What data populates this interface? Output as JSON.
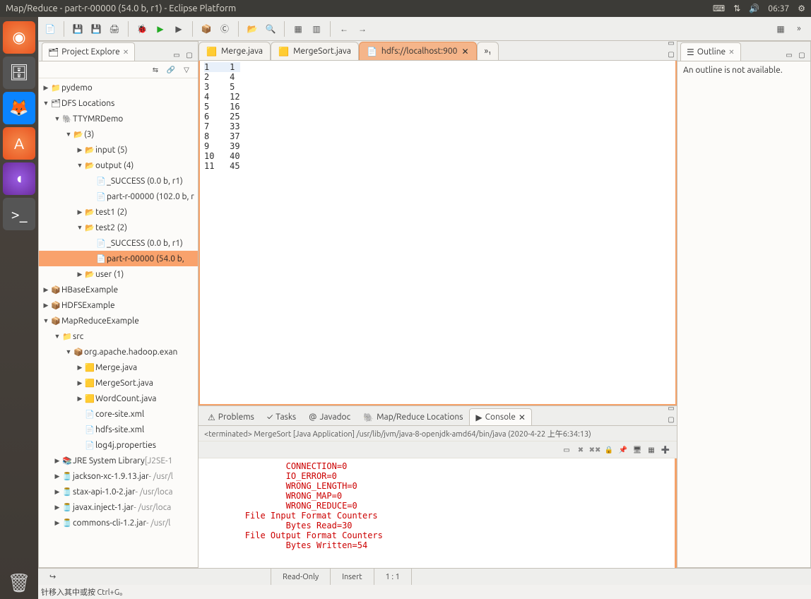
{
  "title": "Map/Reduce - part-r-00000 (54.0 b, r1) - Eclipse Platform",
  "clock": "06:37",
  "explorer": {
    "tab": "Project Explore",
    "items": [
      {
        "depth": 0,
        "twist": "▶",
        "icon": "📁",
        "label": "pydemo"
      },
      {
        "depth": 0,
        "twist": "▼",
        "icon": "🗂",
        "label": "DFS Locations"
      },
      {
        "depth": 1,
        "twist": "▼",
        "icon": "🐘",
        "label": "TTYMRDemo"
      },
      {
        "depth": 2,
        "twist": "▼",
        "icon": "📂",
        "label": "(3)"
      },
      {
        "depth": 3,
        "twist": "▶",
        "icon": "📂",
        "label": "input (5)"
      },
      {
        "depth": 3,
        "twist": "▼",
        "icon": "📂",
        "label": "output (4)"
      },
      {
        "depth": 4,
        "twist": "",
        "icon": "📄",
        "label": "_SUCCESS (0.0 b, r1)"
      },
      {
        "depth": 4,
        "twist": "",
        "icon": "📄",
        "label": "part-r-00000 (102.0 b, r"
      },
      {
        "depth": 3,
        "twist": "▶",
        "icon": "📂",
        "label": "test1 (2)"
      },
      {
        "depth": 3,
        "twist": "▼",
        "icon": "📂",
        "label": "test2 (2)"
      },
      {
        "depth": 4,
        "twist": "",
        "icon": "📄",
        "label": "_SUCCESS (0.0 b, r1)"
      },
      {
        "depth": 4,
        "twist": "",
        "icon": "📄",
        "label": "part-r-00000 (54.0 b,",
        "selected": true
      },
      {
        "depth": 3,
        "twist": "▶",
        "icon": "📂",
        "label": "user (1)"
      },
      {
        "depth": 0,
        "twist": "▶",
        "icon": "📦",
        "label": "HBaseExample"
      },
      {
        "depth": 0,
        "twist": "▶",
        "icon": "📦",
        "label": "HDFSExample"
      },
      {
        "depth": 0,
        "twist": "▼",
        "icon": "📦",
        "label": "MapReduceExample"
      },
      {
        "depth": 1,
        "twist": "▼",
        "icon": "📁",
        "label": "src"
      },
      {
        "depth": 2,
        "twist": "▼",
        "icon": "📦",
        "label": "org.apache.hadoop.exan"
      },
      {
        "depth": 3,
        "twist": "▶",
        "icon": "🟨",
        "label": "Merge.java"
      },
      {
        "depth": 3,
        "twist": "▶",
        "icon": "🟨",
        "label": "MergeSort.java"
      },
      {
        "depth": 3,
        "twist": "▶",
        "icon": "🟨",
        "label": "WordCount.java"
      },
      {
        "depth": 3,
        "twist": "",
        "icon": "📄",
        "label": "core-site.xml"
      },
      {
        "depth": 3,
        "twist": "",
        "icon": "📄",
        "label": "hdfs-site.xml"
      },
      {
        "depth": 3,
        "twist": "",
        "icon": "📄",
        "label": "log4j.properties"
      },
      {
        "depth": 1,
        "twist": "▶",
        "icon": "📚",
        "label": "JRE System Library",
        "suffix": "[J2SE-1"
      },
      {
        "depth": 1,
        "twist": "▶",
        "icon": "🫙",
        "label": "jackson-xc-1.9.13.jar",
        "suffix": " - /usr/l"
      },
      {
        "depth": 1,
        "twist": "▶",
        "icon": "🫙",
        "label": "stax-api-1.0-2.jar",
        "suffix": " - /usr/loca"
      },
      {
        "depth": 1,
        "twist": "▶",
        "icon": "🫙",
        "label": "javax.inject-1.jar",
        "suffix": " - /usr/loca"
      },
      {
        "depth": 1,
        "twist": "▶",
        "icon": "🫙",
        "label": "commons-cli-1.2.jar",
        "suffix": " - /usr/l"
      }
    ]
  },
  "editor": {
    "tabs": [
      {
        "label": "Merge.java",
        "icon": "🟨"
      },
      {
        "label": "MergeSort.java",
        "icon": "🟨"
      },
      {
        "label": "hdfs://localhost:900",
        "icon": "📄",
        "active": true
      },
      {
        "label": "»₁",
        "icon": ""
      }
    ],
    "lines": [
      "1    1",
      "2    4",
      "3    5",
      "4    12",
      "5    16",
      "6    25",
      "7    33",
      "8    37",
      "9    39",
      "10   40",
      "11   45"
    ]
  },
  "outline": {
    "tab": "Outline",
    "body": "An outline is not available."
  },
  "bottom": {
    "tabs": [
      "Problems",
      "Tasks",
      "Javadoc",
      "Map/Reduce Locations",
      "Console"
    ],
    "activeTab": 4,
    "consoleHeader": "<terminated> MergeSort [Java Application] /usr/lib/jvm/java-8-openjdk-amd64/bin/java (2020-4-22 上午6:34:13)",
    "consoleLines": [
      "                CONNECTION=0",
      "                IO_ERROR=0",
      "                WRONG_LENGTH=0",
      "                WRONG_MAP=0",
      "                WRONG_REDUCE=0",
      "        File Input Format Counters ",
      "                Bytes Read=30",
      "        File Output Format Counters ",
      "                Bytes Written=54"
    ]
  },
  "status": {
    "readonly": "Read-Only",
    "insert": "Insert",
    "pos": "1 : 1"
  },
  "hint": "针移入其中或按 Ctrl+G。"
}
